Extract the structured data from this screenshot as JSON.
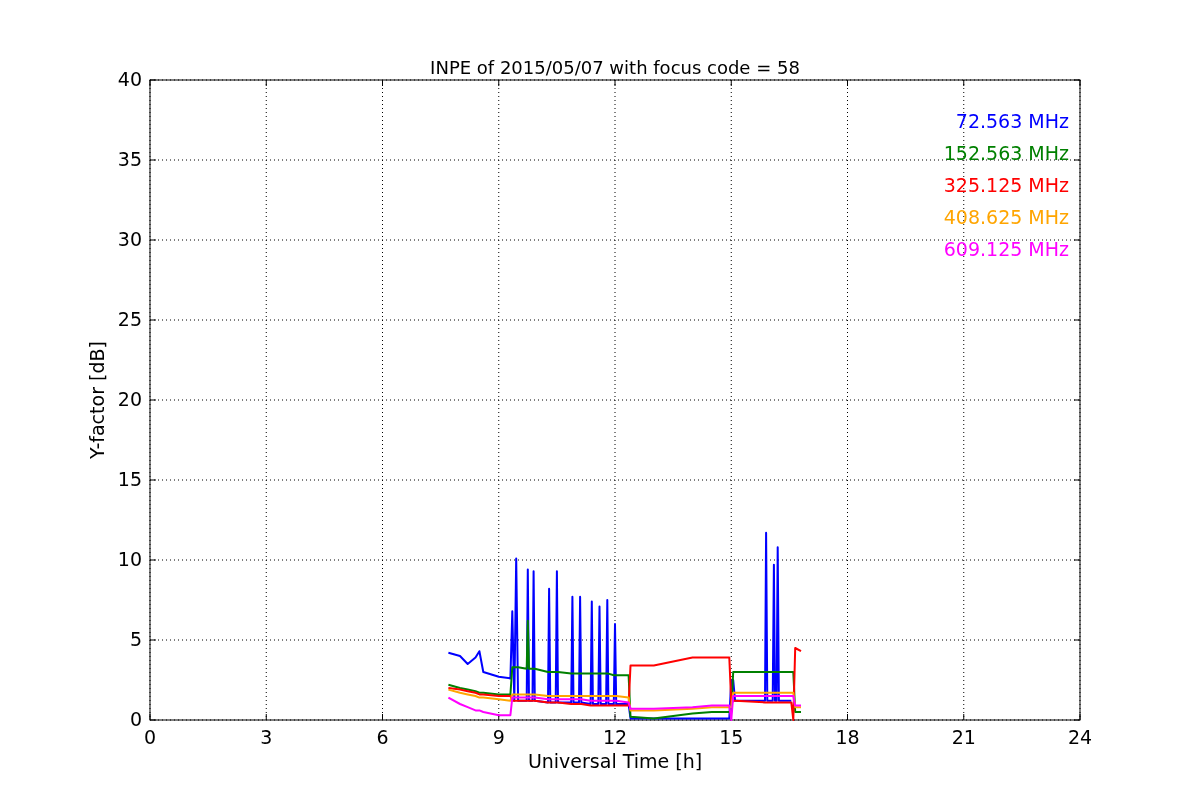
{
  "figure": {
    "chart_data": {
      "type": "line",
      "title": "INPE of 2015/05/07 with focus code = 58",
      "xlabel": "Universal Time [h]",
      "ylabel": "Y-factor [dB]",
      "x": [
        7.7,
        8.0,
        8.2,
        8.4,
        8.5,
        8.6,
        9.0,
        9.3,
        9.35,
        9.4,
        9.45,
        9.5,
        9.72,
        9.75,
        9.78,
        9.87,
        9.9,
        9.93,
        10.27,
        10.3,
        10.33,
        10.47,
        10.5,
        10.53,
        10.87,
        10.9,
        10.93,
        11.07,
        11.1,
        11.13,
        11.37,
        11.4,
        11.43,
        11.57,
        11.6,
        11.63,
        11.77,
        11.8,
        11.83,
        11.97,
        12.0,
        12.03,
        12.35,
        12.4,
        13.0,
        14.0,
        14.5,
        14.95,
        15.0,
        15.05,
        15.1,
        15.87,
        15.9,
        15.93,
        16.07,
        16.1,
        16.13,
        16.17,
        16.2,
        16.23,
        16.55,
        16.6,
        16.65,
        16.8
      ],
      "series": [
        {
          "name": "72.563 MHz",
          "color": "#0000ff",
          "values": [
            4.2,
            4.0,
            3.5,
            3.9,
            4.3,
            3.0,
            2.7,
            2.6,
            6.8,
            1.2,
            10.1,
            1.2,
            1.2,
            9.4,
            1.2,
            1.2,
            9.3,
            1.2,
            1.1,
            8.2,
            1.1,
            1.1,
            9.3,
            1.1,
            1.1,
            7.7,
            1.1,
            1.1,
            7.7,
            1.1,
            1.0,
            7.4,
            1.0,
            1.0,
            7.1,
            1.0,
            1.0,
            7.5,
            1.0,
            1.0,
            6.0,
            1.0,
            1.0,
            0.1,
            0.1,
            0.1,
            0.1,
            0.1,
            2.5,
            2.5,
            1.2,
            1.2,
            11.7,
            1.2,
            1.2,
            9.7,
            1.2,
            1.2,
            10.8,
            1.2,
            1.2,
            null,
            null,
            null
          ]
        },
        {
          "name": "152.563 MHz",
          "color": "#008000",
          "values": [
            2.2,
            2.0,
            1.9,
            1.8,
            1.7,
            1.7,
            1.6,
            1.6,
            3.3,
            3.3,
            3.3,
            3.3,
            3.2,
            6.2,
            3.2,
            3.2,
            3.2,
            3.2,
            3.0,
            3.0,
            3.0,
            3.0,
            3.0,
            3.0,
            2.9,
            2.9,
            2.9,
            2.9,
            2.9,
            2.9,
            2.9,
            2.9,
            2.9,
            2.9,
            2.9,
            2.9,
            2.9,
            2.9,
            2.9,
            2.8,
            2.8,
            2.8,
            2.8,
            0.2,
            0.1,
            0.4,
            0.5,
            0.5,
            0.5,
            3.0,
            3.0,
            3.0,
            3.0,
            3.0,
            3.0,
            3.0,
            3.0,
            3.0,
            3.0,
            3.0,
            3.0,
            3.0,
            0.5,
            0.5
          ]
        },
        {
          "name": "325.125 MHz",
          "color": "#ff0000",
          "values": [
            2.0,
            1.9,
            1.8,
            1.7,
            1.6,
            1.6,
            1.5,
            1.5,
            1.2,
            1.2,
            1.2,
            1.2,
            1.2,
            1.2,
            1.2,
            1.2,
            1.2,
            1.2,
            1.1,
            1.1,
            1.1,
            1.1,
            1.1,
            1.1,
            1.0,
            1.0,
            1.0,
            1.0,
            1.0,
            1.0,
            0.9,
            0.9,
            0.9,
            0.9,
            0.9,
            0.9,
            0.9,
            0.9,
            0.9,
            0.9,
            0.9,
            0.9,
            0.9,
            3.4,
            3.4,
            3.9,
            3.9,
            3.9,
            1.0,
            1.2,
            1.2,
            1.1,
            1.1,
            1.1,
            1.1,
            1.1,
            1.1,
            1.1,
            1.1,
            1.1,
            1.1,
            0.0,
            4.5,
            4.3
          ]
        },
        {
          "name": "408.625 MHz",
          "color": "#ffa500",
          "values": [
            1.9,
            1.7,
            1.6,
            1.5,
            1.4,
            1.4,
            1.3,
            1.2,
            1.6,
            1.6,
            1.6,
            1.6,
            1.6,
            1.6,
            1.6,
            1.6,
            1.6,
            1.6,
            1.5,
            1.5,
            1.5,
            1.5,
            1.5,
            1.5,
            1.5,
            1.5,
            1.5,
            1.5,
            1.5,
            1.5,
            1.5,
            1.5,
            1.5,
            1.5,
            1.5,
            1.5,
            1.5,
            1.5,
            1.5,
            1.5,
            1.5,
            1.5,
            1.4,
            0.6,
            0.6,
            0.7,
            0.8,
            0.8,
            0.8,
            1.7,
            1.7,
            1.7,
            1.7,
            1.7,
            1.7,
            1.7,
            1.7,
            1.7,
            1.7,
            1.7,
            1.7,
            1.7,
            0.8,
            0.8
          ]
        },
        {
          "name": "609.125 MHz",
          "color": "#ff00ff",
          "values": [
            1.4,
            1.0,
            0.8,
            0.6,
            0.6,
            0.5,
            0.3,
            0.3,
            1.4,
            1.4,
            1.4,
            1.4,
            1.4,
            1.4,
            1.4,
            1.4,
            1.4,
            1.4,
            1.3,
            1.3,
            1.3,
            1.3,
            1.3,
            1.3,
            1.3,
            1.3,
            1.3,
            1.3,
            1.3,
            1.3,
            1.2,
            1.2,
            1.2,
            1.2,
            1.2,
            1.2,
            1.2,
            1.2,
            1.2,
            1.2,
            1.2,
            1.2,
            1.1,
            0.7,
            0.7,
            0.8,
            0.9,
            0.9,
            0.0,
            1.5,
            1.5,
            1.5,
            1.5,
            1.5,
            1.5,
            1.5,
            1.5,
            1.5,
            1.5,
            1.5,
            1.5,
            1.5,
            0.9,
            0.9
          ]
        }
      ],
      "xlim": [
        0,
        24
      ],
      "ylim": [
        0,
        40
      ],
      "grid": true,
      "xticks": [
        0,
        3,
        6,
        9,
        12,
        15,
        18,
        21,
        24
      ],
      "yticks": [
        0,
        5,
        10,
        15,
        20,
        25,
        30,
        35,
        40
      ]
    }
  }
}
